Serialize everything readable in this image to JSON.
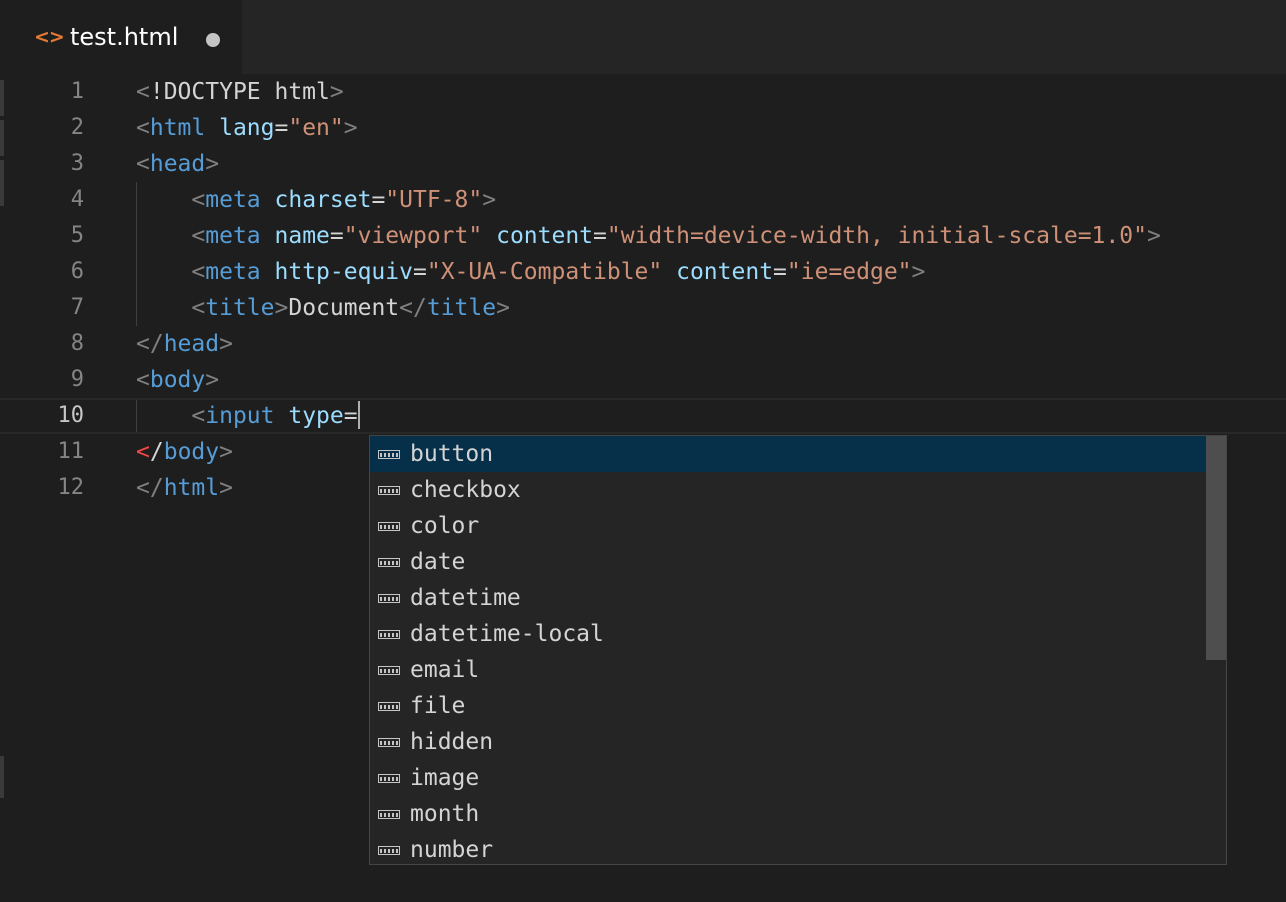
{
  "colors": {
    "editor_background": "#1e1e1e",
    "tab_inactive_background": "#252526",
    "tag_color": "#569cd6",
    "attribute_color": "#9cdcfe",
    "string_color": "#ce9178",
    "punctuation_color": "#808080",
    "error_color": "#f44747",
    "selected_suggestion": "#062f4a",
    "file_icon_color": "#e37933"
  },
  "tab": {
    "icon": "code-brackets-icon",
    "title": "test.html",
    "dirty_indicator": "unsaved-dot-icon"
  },
  "editor": {
    "current_line": 10,
    "lines": [
      {
        "number": "1",
        "tokens": [
          "<",
          "!DOCTYPE html",
          ">"
        ]
      },
      {
        "number": "2",
        "tokens": [
          "<",
          "html",
          " ",
          "lang",
          "=",
          "\"en\"",
          ">"
        ]
      },
      {
        "number": "3",
        "tokens": [
          "<",
          "head",
          ">"
        ]
      },
      {
        "number": "4",
        "tokens": [
          "    ",
          "<",
          "meta",
          " ",
          "charset",
          "=",
          "\"UTF-8\"",
          ">"
        ]
      },
      {
        "number": "5",
        "tokens": [
          "    ",
          "<",
          "meta",
          " ",
          "name",
          "=",
          "\"viewport\"",
          " ",
          "content",
          "=",
          "\"width=device-width, initial-scale=1.0\"",
          ">"
        ]
      },
      {
        "number": "6",
        "tokens": [
          "    ",
          "<",
          "meta",
          " ",
          "http-equiv",
          "=",
          "\"X-UA-Compatible\"",
          " ",
          "content",
          "=",
          "\"ie=edge\"",
          ">"
        ]
      },
      {
        "number": "7",
        "tokens": [
          "    ",
          "<",
          "title",
          ">",
          "Document",
          "</",
          "title",
          ">"
        ]
      },
      {
        "number": "8",
        "tokens": [
          "</",
          "head",
          ">"
        ]
      },
      {
        "number": "9",
        "tokens": [
          "<",
          "body",
          ">"
        ]
      },
      {
        "number": "10",
        "tokens": [
          "    ",
          "<",
          "input",
          " ",
          "type",
          "="
        ]
      },
      {
        "number": "11",
        "tokens": [
          "<",
          "/",
          "body",
          ">"
        ]
      },
      {
        "number": "12",
        "tokens": [
          "</",
          "html",
          ">"
        ]
      }
    ]
  },
  "suggest": {
    "item_icon": "enum-value-icon",
    "selected_index": 0,
    "items": [
      {
        "label": "button"
      },
      {
        "label": "checkbox"
      },
      {
        "label": "color"
      },
      {
        "label": "date"
      },
      {
        "label": "datetime"
      },
      {
        "label": "datetime-local"
      },
      {
        "label": "email"
      },
      {
        "label": "file"
      },
      {
        "label": "hidden"
      },
      {
        "label": "image"
      },
      {
        "label": "month"
      },
      {
        "label": "number"
      }
    ]
  }
}
